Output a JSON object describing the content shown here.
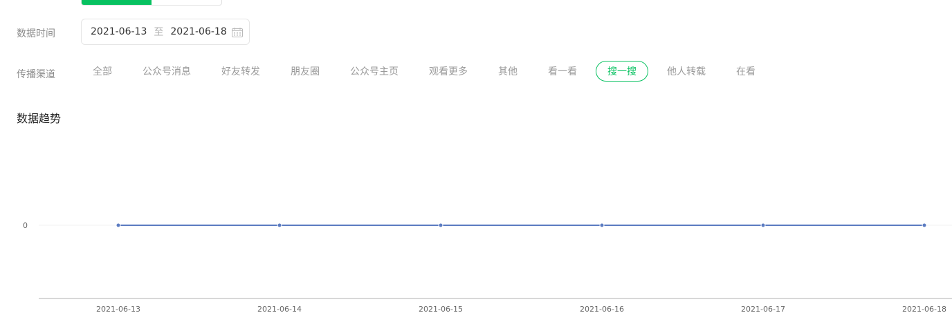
{
  "filters": {
    "date_label": "数据时间",
    "date_start": "2021-06-13",
    "date_separator": "至",
    "date_end": "2021-06-18",
    "calendar_icon": "calendar-icon",
    "channel_label": "传播渠道",
    "channels": [
      "全部",
      "公众号消息",
      "好友转发",
      "朋友圈",
      "公众号主页",
      "观看更多",
      "其他",
      "看一看",
      "搜一搜",
      "他人转载",
      "在看"
    ],
    "active_channel": "搜一搜"
  },
  "section": {
    "title": "数据趋势"
  },
  "colors": {
    "accent": "#07c160",
    "line": "#5b7bc1"
  },
  "chart_data": {
    "type": "line",
    "x": [
      "2021-06-13",
      "2021-06-14",
      "2021-06-15",
      "2021-06-16",
      "2021-06-17",
      "2021-06-18"
    ],
    "series": [
      {
        "values": [
          0,
          0,
          0,
          0,
          0,
          0
        ]
      }
    ],
    "y_ticks": [
      "0"
    ],
    "grid": true
  }
}
